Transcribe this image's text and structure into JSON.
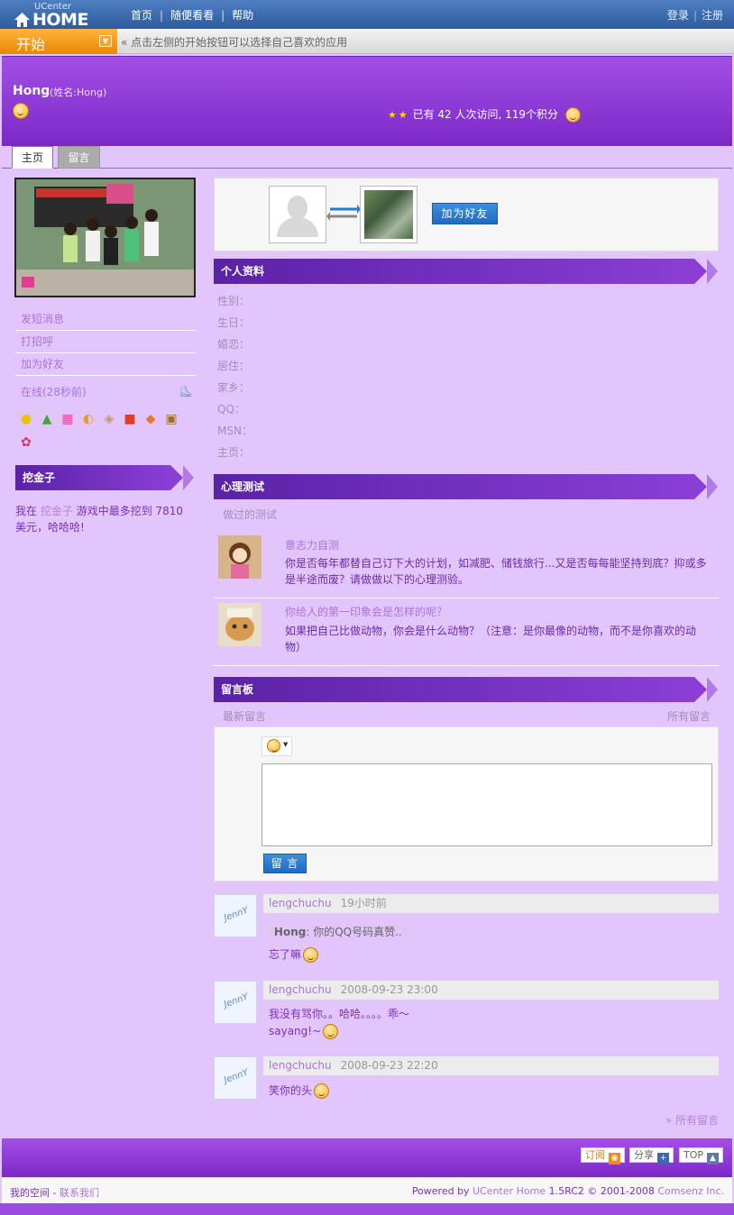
{
  "topbar": {
    "logo_small": "UCenter",
    "logo_big": "HOME",
    "nav": [
      "首页",
      "随便看看",
      "帮助"
    ],
    "login": "登录",
    "register": "注册"
  },
  "appbar": {
    "start": "开始",
    "hint": "« 点击左侧的开始按钮可以选择自己喜欢的应用"
  },
  "profile": {
    "username": "Hong",
    "realname": "(姓名:Hong)",
    "stats": "已有 42 人次访问, 119个积分"
  },
  "tabs": [
    "主页",
    "留言"
  ],
  "left": {
    "links": [
      "发短消息",
      "打招呼",
      "加为好友"
    ],
    "online": "在线(28秒前)",
    "dig_title": "挖金子",
    "dig_pre": "我在",
    "dig_game": "挖金子",
    "dig_post": "游戏中最多挖到 7810 美元，哈哈哈!"
  },
  "friend": {
    "add_button": "加为好友"
  },
  "profile_section": {
    "title": "个人资料",
    "fields": [
      "性别：",
      "生日：",
      "婚恋：",
      "居住：",
      "家乡：",
      "QQ：",
      "MSN：",
      "主页："
    ]
  },
  "quiz_section": {
    "title": "心理测试",
    "subtitle": "做过的测试",
    "items": [
      {
        "title": "意志力自测",
        "desc": "你是否每年都替自己订下大的计划，如减肥、储钱旅行...又是否每每能坚持到底？抑或多是半途而废？请做做以下的心理测验。"
      },
      {
        "title": "你给人的第一印象会是怎样的呢？",
        "desc": "如果把自己比做动物，你会是什么动物？（注意：是你最像的动物，而不是你喜欢的动物）"
      }
    ]
  },
  "board": {
    "title": "留言板",
    "latest": "最新留言",
    "all": "所有留言",
    "submit": "留 言",
    "more": "» 所有留言",
    "comments": [
      {
        "author": "lengchuchu",
        "time": "19小时前",
        "quote_name": "Hong",
        "quote_text": ": 你的QQ号码真赞..",
        "text": "忘了嘛"
      },
      {
        "author": "lengchuchu",
        "time": "2008-09-23 23:00",
        "text": "我没有骂你。。哈哈。。。。乖～",
        "text2": "sayang!~"
      },
      {
        "author": "lengchuchu",
        "time": "2008-09-23 22:20",
        "text": "笑你的头"
      }
    ]
  },
  "footer": {
    "subscribe": "订阅",
    "share": "分享",
    "top": "TOP",
    "my_space": "我的空间",
    "separator": " - ",
    "contact": "联系我们",
    "powered_by": "Powered by",
    "product": "UCenter Home",
    "version": "1.5RC2 © 2001-2008",
    "company": "Comsenz Inc."
  }
}
